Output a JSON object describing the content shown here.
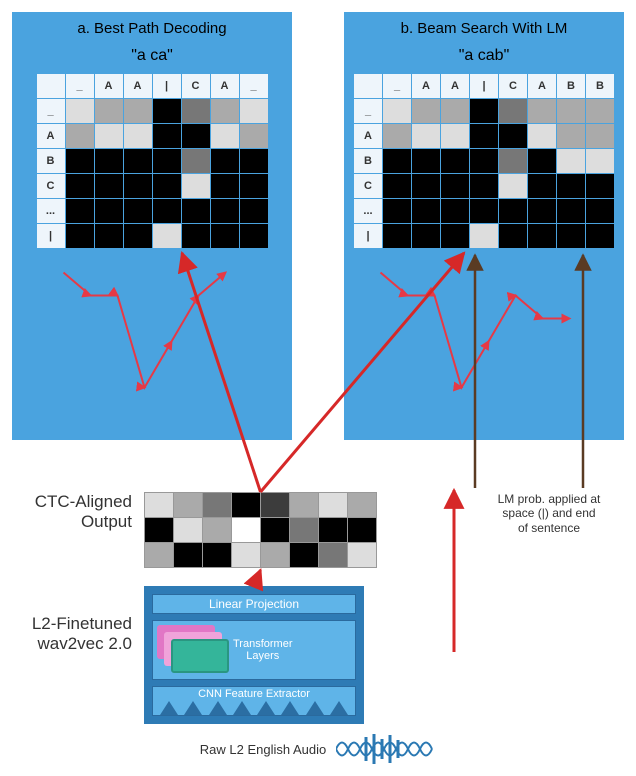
{
  "panel_a": {
    "title": "a. Best Path Decoding",
    "output": "\"a ca\"",
    "col_headers": [
      "_",
      "A",
      "A",
      "|",
      "C",
      "A",
      "_"
    ],
    "row_headers": [
      "_",
      "A",
      "B",
      "C",
      "...",
      "|"
    ]
  },
  "panel_b": {
    "title": "b. Beam Search With LM",
    "output": "\"a cab\"",
    "col_headers": [
      "_",
      "A",
      "A",
      "|",
      "C",
      "A",
      "B",
      "B"
    ],
    "row_headers": [
      "_",
      "A",
      "B",
      "C",
      "...",
      "|"
    ]
  },
  "ctc_label_line1": "CTC-Aligned",
  "ctc_label_line2": "Output",
  "lm_note_line1": "LM prob. applied at",
  "lm_note_line2": "space (|) and end",
  "lm_note_line3": "of sentence",
  "wav_label_line1": "L2-Finetuned",
  "wav_label_line2": "wav2vec 2.0",
  "stack": {
    "linear": "Linear Projection",
    "transformer": "Transformer\nLayers",
    "cnn": "CNN Feature Extractor"
  },
  "audio_label": "Raw L2 English Audio",
  "ctc_cells": [
    [
      "d4",
      "d3",
      "d2",
      "k",
      "d1",
      "d3",
      "d4",
      "d3"
    ],
    [
      "k",
      "d4",
      "d3",
      "w",
      "k",
      "d2",
      "k",
      "k"
    ],
    [
      "d3",
      "k",
      "k",
      "d4",
      "d3",
      "k",
      "d2",
      "d4"
    ]
  ],
  "panel_a_cells": [
    [
      "d4",
      "d3",
      "d3",
      "k",
      "d2",
      "d3",
      "d4"
    ],
    [
      "d3",
      "d4",
      "d4",
      "k",
      "k",
      "d4",
      "d3"
    ],
    [
      "k",
      "k",
      "k",
      "k",
      "d2",
      "k",
      "k"
    ],
    [
      "k",
      "k",
      "k",
      "k",
      "d4",
      "k",
      "k"
    ],
    [
      "k",
      "k",
      "k",
      "k",
      "k",
      "k",
      "k"
    ],
    [
      "k",
      "k",
      "k",
      "d4",
      "k",
      "k",
      "k"
    ]
  ],
  "panel_b_cells": [
    [
      "d4",
      "d3",
      "d3",
      "k",
      "d2",
      "d3",
      "d3",
      "d3"
    ],
    [
      "d3",
      "d4",
      "d4",
      "k",
      "k",
      "d4",
      "d3",
      "d3"
    ],
    [
      "k",
      "k",
      "k",
      "k",
      "d2",
      "k",
      "d4",
      "d4"
    ],
    [
      "k",
      "k",
      "k",
      "k",
      "d4",
      "k",
      "k",
      "k"
    ],
    [
      "k",
      "k",
      "k",
      "k",
      "k",
      "k",
      "k",
      "k"
    ],
    [
      "k",
      "k",
      "k",
      "d4",
      "k",
      "k",
      "k",
      "k"
    ]
  ]
}
